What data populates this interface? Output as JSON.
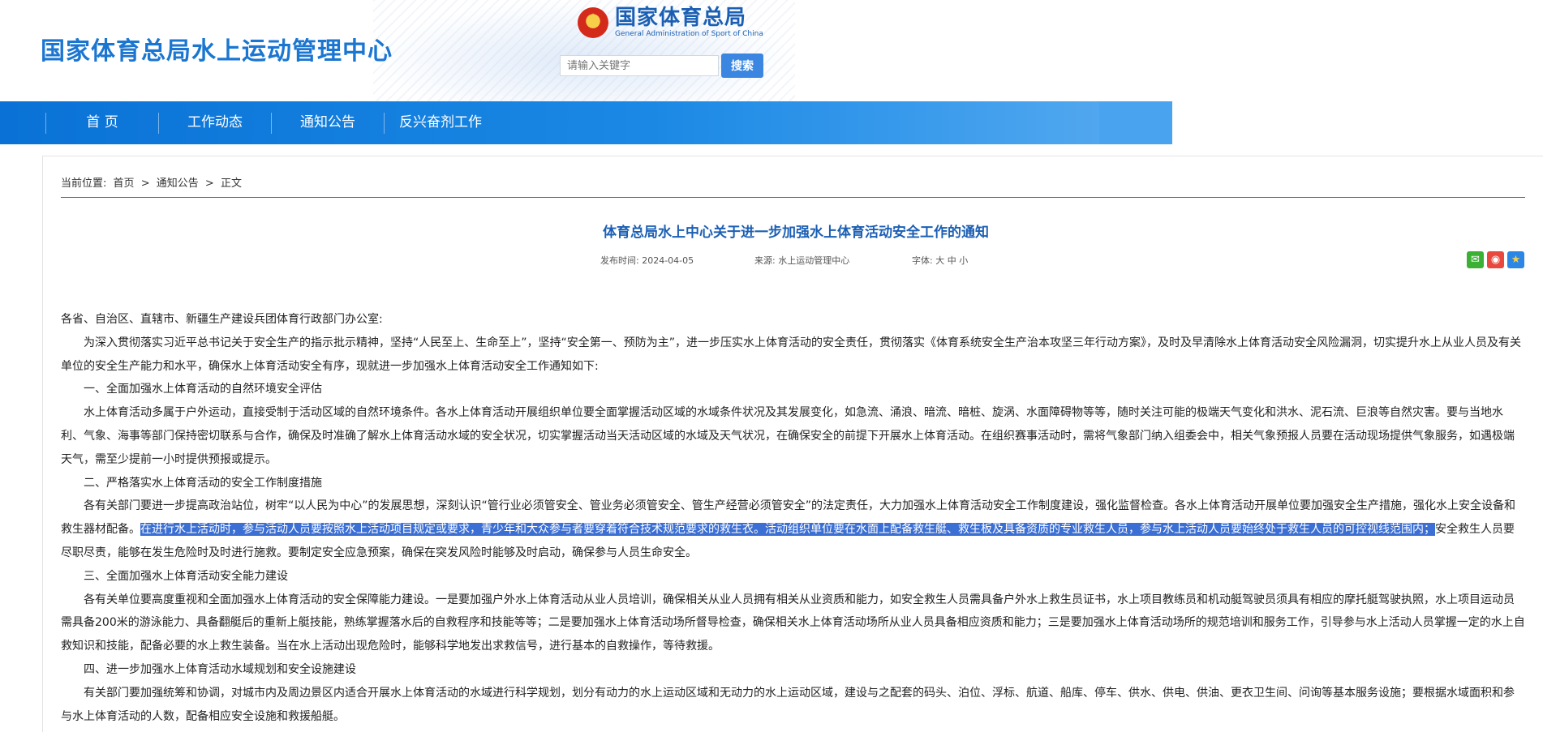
{
  "header": {
    "site_title": "国家体育总局水上运动管理中心",
    "gov_name_cn": "国家体育总局",
    "gov_name_en": "General Administration of Sport of China",
    "search_placeholder": "请输入关键字",
    "search_button": "搜索"
  },
  "nav": {
    "items": [
      "首 页",
      "工作动态",
      "通知公告",
      "反兴奋剂工作"
    ]
  },
  "breadcrumb": {
    "label": "当前位置:",
    "home": "首页",
    "sep1": ">",
    "section": "通知公告",
    "sep2": ">",
    "current": "正文"
  },
  "article": {
    "title": "体育总局水上中心关于进一步加强水上体育活动安全工作的通知",
    "publish_label": "发布时间:",
    "publish_date": "2024-04-05",
    "source_label": "来源:",
    "source": "水上运动管理中心",
    "font_label": "字体:",
    "font_large": "大",
    "font_medium": "中",
    "font_small": "小",
    "salutation": "各省、自治区、直辖市、新疆生产建设兵团体育行政部门办公室:",
    "intro": "为深入贯彻落实习近平总书记关于安全生产的指示批示精神，坚持“人民至上、生命至上”，坚持“安全第一、预防为主”，进一步压实水上体育活动的安全责任，贯彻落实《体育系统安全生产治本攻坚三年行动方案》，及时及早清除水上体育活动安全风险漏洞，切实提升水上从业人员及有关单位的安全生产能力和水平，确保水上体育活动安全有序，现就进一步加强水上体育活动安全工作通知如下:",
    "h1": "一、全面加强水上体育活动的自然环境安全评估",
    "p1": "水上体育活动多属于户外运动，直接受制于活动区域的自然环境条件。各水上体育活动开展组织单位要全面掌握活动区域的水域条件状况及其发展变化，如急流、涌浪、暗流、暗桩、旋涡、水面障碍物等等，随时关注可能的极端天气变化和洪水、泥石流、巨浪等自然灾害。要与当地水利、气象、海事等部门保持密切联系与合作，确保及时准确了解水上体育活动水域的安全状况，切实掌握活动当天活动区域的水域及天气状况，在确保安全的前提下开展水上体育活动。在组织赛事活动时，需将气象部门纳入组委会中，相关气象预报人员要在活动现场提供气象服务，如遇极端天气，需至少提前一小时提供预报或提示。",
    "h2": "二、严格落实水上体育活动的安全工作制度措施",
    "p2a": "各有关部门要进一步提高政治站位，树牢“以人民为中心”的发展思想，深刻认识“管行业必须管安全、管业务必须管安全、管生产经营必须管安全”的法定责任，大力加强水上体育活动安全工作制度建设，强化监督检查。各水上体育活动开展单位要加强安全生产措施，强化水上安全设备和救生器材配备。",
    "p2hl": "在进行水上活动时，参与活动人员要按照水上活动项目规定或要求，青少年和大众参与者要穿着符合技术规范要求的救生衣。活动组织单位要在水面上配备救生艇、救生板及具备资质的专业救生人员，参与水上活动人员要始终处于救生人员的可控视线范围内；",
    "p2b": "安全救生人员要尽职尽责，能够在发生危险时及时进行施救。要制定安全应急预案，确保在突发风险时能够及时启动，确保参与人员生命安全。",
    "h3": "三、全面加强水上体育活动安全能力建设",
    "p3": "各有关单位要高度重视和全面加强水上体育活动的安全保障能力建设。一是要加强户外水上体育活动从业人员培训，确保相关从业人员拥有相关从业资质和能力，如安全救生人员需具备户外水上救生员证书，水上项目教练员和机动艇驾驶员须具有相应的摩托艇驾驶执照，水上项目运动员需具备200米的游泳能力、具备翻艇后的重新上艇技能，熟练掌握落水后的自救程序和技能等等；二是要加强水上体育活动场所督导检查，确保相关水上体育活动场所从业人员具备相应资质和能力；三是要加强水上体育活动场所的规范培训和服务工作，引导参与水上活动人员掌握一定的水上自救知识和技能，配备必要的水上救生装备。当在水上活动出现危险时，能够科学地发出求救信号，进行基本的自救操作，等待救援。",
    "h4": "四、进一步加强水上体育活动水域规划和安全设施建设",
    "p4": "有关部门要加强统筹和协调，对城市内及周边景区内适合开展水上体育活动的水域进行科学规划，划分有动力的水上运动区域和无动力的水上运动区域，建设与之配套的码头、泊位、浮标、航道、船库、停车、供水、供电、供油、更衣卫生间、问询等基本服务设施；要根据水域面积和参与水上体育活动的人数，配备相应安全设施和救援船艇。"
  },
  "share": {
    "wechat_icon": "wechat-icon",
    "weibo_icon": "weibo-icon",
    "favorite_icon": "star-icon",
    "colors": {
      "wechat": "#3cb034",
      "weibo": "#e8483d",
      "favorite": "#2c86e6"
    }
  },
  "colors": {
    "brand": "#1b76d2",
    "nav": "#0a72d6",
    "highlight": "#3b6fd3"
  }
}
